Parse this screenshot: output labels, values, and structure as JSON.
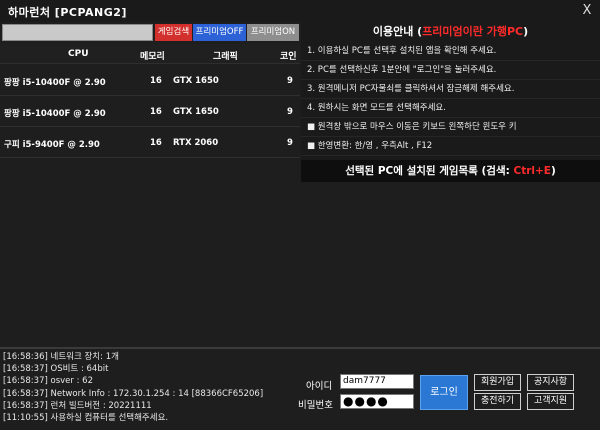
{
  "window": {
    "title": "하마런처 [PCPANG2]",
    "close_label": "X"
  },
  "toolbar": {
    "search_value": "",
    "game_search_label": "게임검색",
    "premium_off_label": "프리미엄OFF",
    "premium_on_label": "프리미엄ON"
  },
  "pc_table": {
    "headers": {
      "cpu": "CPU",
      "memory": "메모리",
      "gpu": "그래픽",
      "coin": "코인"
    },
    "rows": [
      {
        "cpu": "팡팡 i5-10400F @ 2.90",
        "memory": "16",
        "gpu": "GTX 1650",
        "coin": "9"
      },
      {
        "cpu": "팡팡 i5-10400F @ 2.90",
        "memory": "16",
        "gpu": "GTX 1650",
        "coin": "9"
      },
      {
        "cpu": "구피 i5-9400F @ 2.90",
        "memory": "16",
        "gpu": "RTX 2060",
        "coin": "9"
      }
    ]
  },
  "info": {
    "header_prefix": "이용안내 (",
    "header_highlight": "프리미엄이란 가행PC",
    "header_suffix": ")",
    "lines": [
      "1. 이용하실 PC를 선택후 설치된 앱을 확인해 주세요.",
      "2. PC를 선택하신후 1분안에 \"로그인\"을 눌러주세요.",
      "3. 원격메니저 PC자물쇠를 클릭하셔서 잠금해제 해주세요.",
      "4. 원하시는 화면 모드를 선택해주세요.",
      "■ 원격창 밖으로 마우스 이동은 키보드 왼쪽하단 윈도우 키",
      "■ 한영변환: 한/영 , 우측Alt , F12"
    ],
    "games_title_prefix": "선택된 PC에 설치된 게임목록 (검색: ",
    "games_title_key": "Ctrl+E",
    "games_title_suffix": ")"
  },
  "log": [
    "[16:58:36] 네트워크 장치: 1개",
    "[16:58:37] OS비트 : 64bit",
    "[16:58:37] osver : 62",
    "[16:58:37] Network Info : 172.30.1.254 : 14 [88366CF65206]",
    "[16:58:37] 런처 빌드버전 : 20221111",
    "[11:10:55] 사용하실 컴퓨터를 선택해주세요."
  ],
  "login": {
    "id_label": "아이디",
    "id_value": "dam7777",
    "pw_label": "비밀번호",
    "pw_mask": "●●●●",
    "login_label": "로그인",
    "signup_label": "회원가입",
    "notice_label": "공지사항",
    "charge_label": "충전하기",
    "support_label": "고객지원"
  },
  "colors": {
    "red": "#d2302c",
    "blue": "#2d62d6",
    "highlight_red": "#ff2b2b",
    "login_blue": "#2a78d4"
  }
}
